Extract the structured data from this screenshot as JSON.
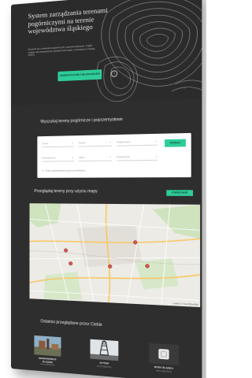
{
  "hero": {
    "title": "System zarządzania terenami pogórniczymi na terenie województwa śląskiego",
    "description": "Dowiedz się o terenach pogórniczych i poprzemysłowych, znajdź miejsce dla inwestycji lub sprawdź informacje o obszarach w Twojej okolicy.",
    "cta_label": "SKONTAKTUJ SIĘ Z WŁAŚCICIELEM",
    "help_icon": "?"
  },
  "search": {
    "heading": "Wyszukaj tereny pogórnicze i poprzemysłowe",
    "selects": [
      "Gmina",
      "Powiat",
      "Rodzaj terenu",
      "Przeznaczenie",
      "Status",
      "Powierzchnia"
    ],
    "button_label": "SZUKAJ",
    "clear_label": "Zmień zaawansowane opcje wyszukiwania..."
  },
  "map_section": {
    "heading": "Przeglądaj tereny przy użyciu mapy",
    "button_label": "OTWÓRZ MAPĘ",
    "attribution": "Leaflet | © OpenStreetMap"
  },
  "recent": {
    "heading": "Ostatnio przeglądane przez Ciebie",
    "items": [
      {
        "label": "SIEMIANOWICE ŚLĄSKIE",
        "sub": "teren pogórniczy"
      },
      {
        "label": "BYTOM",
        "sub": "teren pogórniczy"
      },
      {
        "label": "RUDA ŚLĄSKA",
        "sub": "teren pogórniczy"
      }
    ]
  },
  "colors": {
    "background": "#2e2e2e",
    "accent": "#2ecc9a",
    "marker": "#d9534f"
  }
}
